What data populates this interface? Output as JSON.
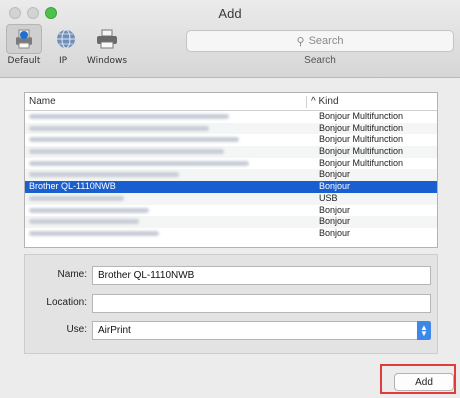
{
  "window": {
    "title": "Add"
  },
  "toolbar": {
    "default_label": "Default",
    "ip_label": "IP",
    "windows_label": "Windows",
    "search_placeholder": "Search",
    "search_caption": "Search"
  },
  "list": {
    "header_name": "Name",
    "header_kind": "Kind",
    "sort_indicator": "^",
    "rows": [
      {
        "name": "",
        "kind": "Bonjour Multifunction",
        "blurred": true
      },
      {
        "name": "",
        "kind": "Bonjour Multifunction",
        "blurred": true
      },
      {
        "name": "",
        "kind": "Bonjour Multifunction",
        "blurred": true
      },
      {
        "name": "",
        "kind": "Bonjour Multifunction",
        "blurred": true
      },
      {
        "name": "",
        "kind": "Bonjour Multifunction",
        "blurred": true
      },
      {
        "name": "",
        "kind": "Bonjour",
        "blurred": true
      },
      {
        "name": "Brother QL-1110NWB",
        "kind": "Bonjour",
        "blurred": false,
        "selected": true
      },
      {
        "name": "",
        "kind": "USB",
        "blurred": true
      },
      {
        "name": "",
        "kind": "Bonjour",
        "blurred": true
      },
      {
        "name": "",
        "kind": "Bonjour",
        "blurred": true
      },
      {
        "name": "",
        "kind": "Bonjour",
        "blurred": true
      }
    ]
  },
  "form": {
    "name_label": "Name:",
    "name_value": "Brother QL-1110NWB",
    "location_label": "Location:",
    "location_value": "",
    "use_label": "Use:",
    "use_value": "AirPrint"
  },
  "footer": {
    "add_label": "Add"
  },
  "colors": {
    "selection": "#1a5fd0",
    "highlight_box": "#e23b3b",
    "select_accent": "#3b87ea"
  }
}
